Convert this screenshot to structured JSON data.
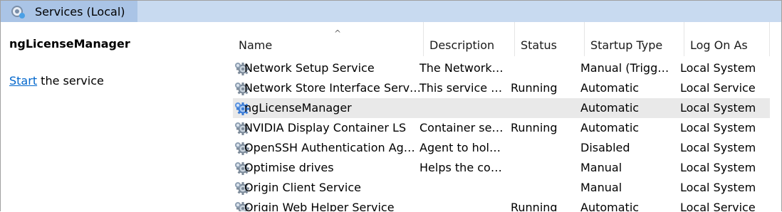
{
  "window": {
    "title": "Services (Local)"
  },
  "left_pane": {
    "service_name": "ngLicenseManager",
    "start_link": "Start",
    "start_suffix": " the service"
  },
  "columns": [
    "Name",
    "Description",
    "Status",
    "Startup Type",
    "Log On As"
  ],
  "rows": [
    {
      "name": "Network Setup Service",
      "description": "The Network…",
      "status": "",
      "startup": "Manual (Trigg…",
      "logon": "Local System",
      "icon": "gear-icon"
    },
    {
      "name": "Network Store Interface Serv…",
      "description": "This service …",
      "status": "Running",
      "startup": "Automatic",
      "logon": "Local Service",
      "icon": "gear-icon"
    },
    {
      "name": "ngLicenseManager",
      "description": "",
      "status": "",
      "startup": "Automatic",
      "logon": "Local System",
      "icon": "gear-icon-selected"
    },
    {
      "name": "NVIDIA Display Container LS",
      "description": "Container se…",
      "status": "Running",
      "startup": "Automatic",
      "logon": "Local System",
      "icon": "gear-icon"
    },
    {
      "name": "OpenSSH Authentication Ag…",
      "description": "Agent to hol…",
      "status": "",
      "startup": "Disabled",
      "logon": "Local System",
      "icon": "gear-icon"
    },
    {
      "name": "Optimise drives",
      "description": "Helps the co…",
      "status": "",
      "startup": "Manual",
      "logon": "Local System",
      "icon": "gear-icon"
    },
    {
      "name": "Origin Client Service",
      "description": "",
      "status": "",
      "startup": "Manual",
      "logon": "Local System",
      "icon": "gear-icon"
    },
    {
      "name": "Origin Web Helper Service",
      "description": "",
      "status": "Running",
      "startup": "Automatic",
      "logon": "Local Service",
      "icon": "gear-icon"
    }
  ],
  "selected_row_index": 2,
  "sort": {
    "column": "Name",
    "direction": "ascending"
  }
}
